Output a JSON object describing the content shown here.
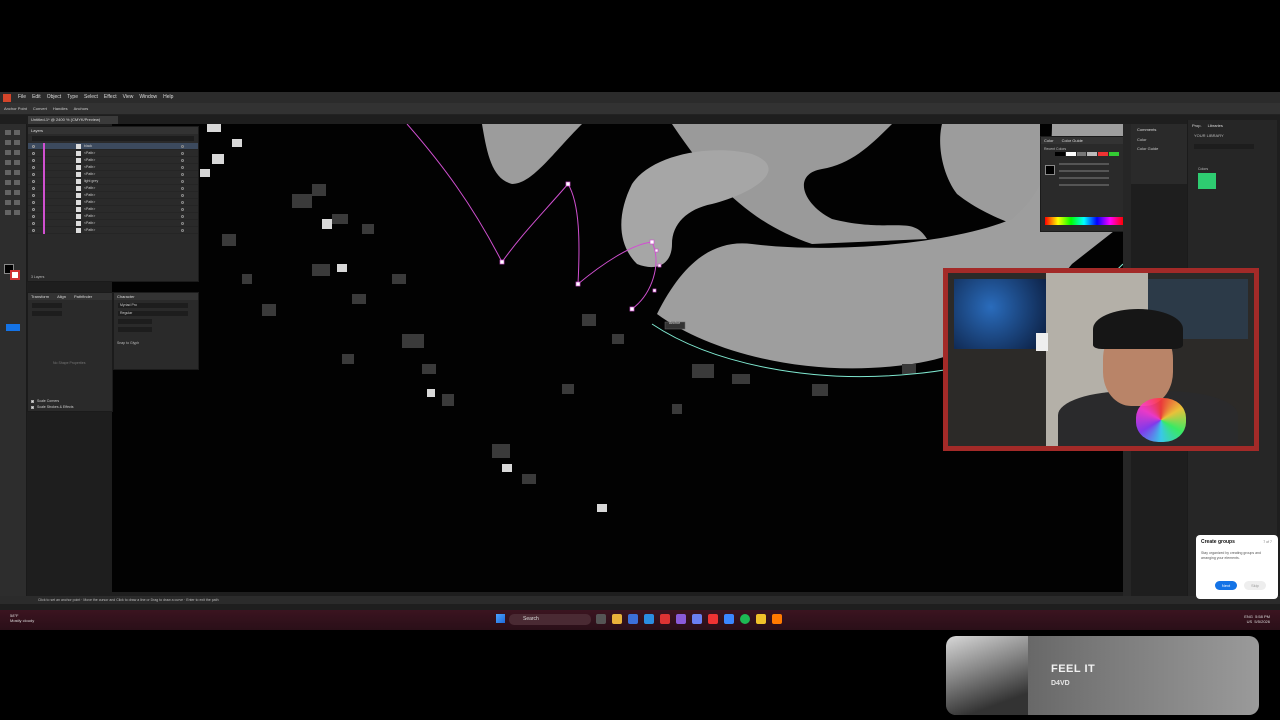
{
  "app": {
    "menu": [
      "File",
      "Edit",
      "Object",
      "Type",
      "Select",
      "Effect",
      "View",
      "Window",
      "Help"
    ],
    "control_bar": [
      "Anchor Point",
      "Convert",
      "Handles",
      "Anchors"
    ],
    "document_tab": "Untitled-1* @ 2400 % (CMYK/Preview)"
  },
  "layers_panel": {
    "title": "Layers",
    "rows": [
      {
        "name": "black",
        "selected": true
      },
      {
        "name": "<Path>"
      },
      {
        "name": "<Path>"
      },
      {
        "name": "<Path>"
      },
      {
        "name": "<Path>"
      },
      {
        "name": "light grey"
      },
      {
        "name": "<Path>"
      },
      {
        "name": "<Path>"
      },
      {
        "name": "<Path>"
      },
      {
        "name": "<Path>"
      },
      {
        "name": "<Path>"
      },
      {
        "name": "<Path>"
      },
      {
        "name": "<Path>"
      }
    ],
    "footer": "3 Layers"
  },
  "transform_panel": {
    "tabs": [
      "Transform",
      "Align",
      "Pathfinder"
    ],
    "empty_text": "No Shape Properties",
    "options": [
      "Scale Corners",
      "Scale Strokes & Effects"
    ]
  },
  "character_panel": {
    "title": "Character",
    "font": "Myriad Pro",
    "style": "Regular",
    "snap": "Snap to Glyph"
  },
  "color_panel": {
    "tabs": [
      "Color",
      "Color Guide"
    ],
    "label": "Recent Colors"
  },
  "comments_panel": {
    "items": [
      "Comments",
      "Color",
      "Color Guide"
    ]
  },
  "libraries_panel": {
    "tabs": [
      "Prop.",
      "Libraries"
    ],
    "title": "YOUR LIBRARY",
    "section": "Colors",
    "swatch_color": "#2ecc71"
  },
  "status_bar": {
    "hint": "Click to set an anchor point · Move the cursor and Click to draw a line or Drag to draw a curve · Enter to exit the path"
  },
  "tooltip": {
    "text": "Anchor"
  },
  "taskbar": {
    "weather_temp": "58°F",
    "weather_desc": "Mostly cloudy",
    "search": "Search",
    "lang": "ENG",
    "region": "US",
    "time": "5:58 PM",
    "date": "5/5/2026"
  },
  "popup": {
    "title": "Create groups",
    "counter": "7 of 7",
    "description": "Stay organized by creating groups and arranging your elements.",
    "next": "Next",
    "skip": "Skip"
  },
  "now_playing": {
    "song": "FEEL IT",
    "artist": "D4VD"
  },
  "colors": {
    "accent": "#1473e6",
    "frame": "#a32a28",
    "path": "#d050d0",
    "guide": "#7fe8d0"
  }
}
